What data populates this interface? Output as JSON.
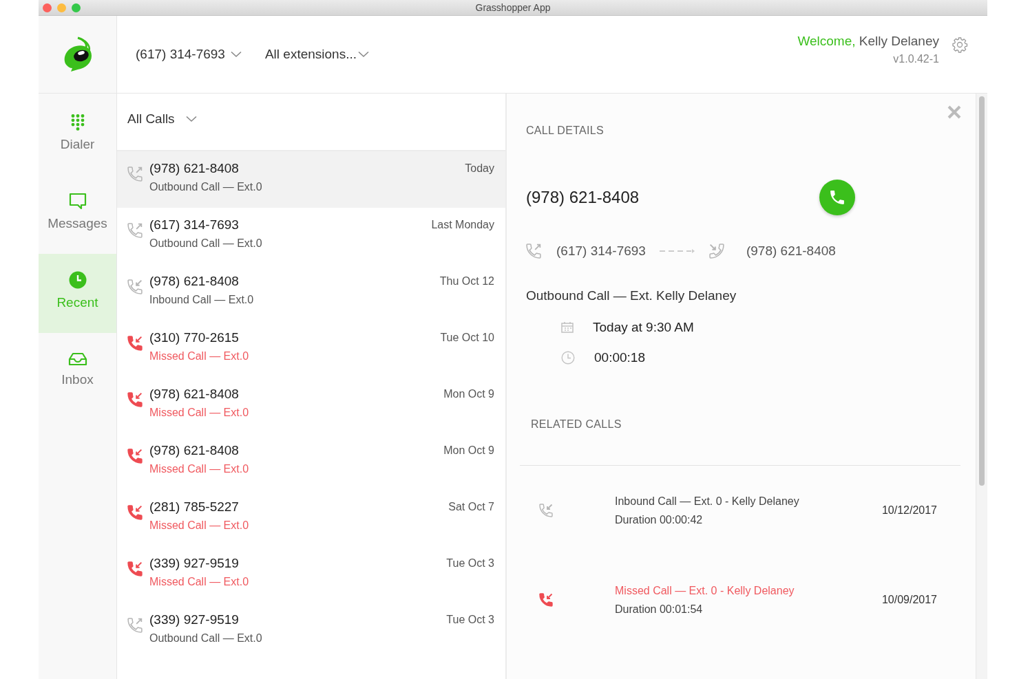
{
  "window": {
    "title": "Grasshopper App"
  },
  "header": {
    "number_selector": "(617) 314-7693",
    "extension_selector": "All extensions...",
    "greeting": "Welcome,",
    "user_name": "Kelly Delaney",
    "version": "v1.0.42-1"
  },
  "nav": [
    {
      "label": "Dialer",
      "selected": false
    },
    {
      "label": "Messages",
      "selected": false
    },
    {
      "label": "Recent",
      "selected": true
    },
    {
      "label": "Inbox",
      "selected": false
    }
  ],
  "calls": {
    "filter": "All Calls",
    "rows": [
      {
        "number": "(978) 621-8408",
        "description": "Outbound Call — Ext.0",
        "date": "Today",
        "kind": "outbound",
        "selected": true
      },
      {
        "number": "(617) 314-7693",
        "description": "Outbound Call — Ext.0",
        "date": "Last Monday",
        "kind": "outbound",
        "selected": false
      },
      {
        "number": "(978) 621-8408",
        "description": "Inbound Call — Ext.0",
        "date": "Thu Oct 12",
        "kind": "inbound",
        "selected": false
      },
      {
        "number": "(310) 770-2615",
        "description": "Missed Call — Ext.0",
        "date": "Tue Oct 10",
        "kind": "missed",
        "selected": false
      },
      {
        "number": "(978) 621-8408",
        "description": "Missed Call — Ext.0",
        "date": "Mon Oct 9",
        "kind": "missed",
        "selected": false
      },
      {
        "number": "(978) 621-8408",
        "description": "Missed Call — Ext.0",
        "date": "Mon Oct 9",
        "kind": "missed",
        "selected": false
      },
      {
        "number": "(281) 785-5227",
        "description": "Missed Call — Ext.0",
        "date": "Sat Oct 7",
        "kind": "missed",
        "selected": false
      },
      {
        "number": "(339) 927-9519",
        "description": "Missed Call — Ext.0",
        "date": "Tue Oct 3",
        "kind": "missed",
        "selected": false
      },
      {
        "number": "(339) 927-9519",
        "description": "Outbound Call — Ext.0",
        "date": "Tue Oct 3",
        "kind": "outbound",
        "selected": false
      }
    ]
  },
  "details": {
    "heading": "CALL DETAILS",
    "number": "(978) 621-8408",
    "from": "(617) 314-7693",
    "to": "(978) 621-8408",
    "description": "Outbound Call — Ext. Kelly Delaney",
    "when": "Today at 9:30 AM",
    "duration": "00:00:18",
    "related_heading": "RELATED CALLS",
    "related": [
      {
        "description": "Inbound Call — Ext. 0 - Kelly Delaney",
        "duration": "Duration 00:00:42",
        "date": "10/12/2017",
        "kind": "inbound"
      },
      {
        "description": "Missed Call — Ext. 0 - Kelly Delaney",
        "duration": "Duration 00:01:54",
        "date": "10/09/2017",
        "kind": "missed"
      }
    ]
  }
}
